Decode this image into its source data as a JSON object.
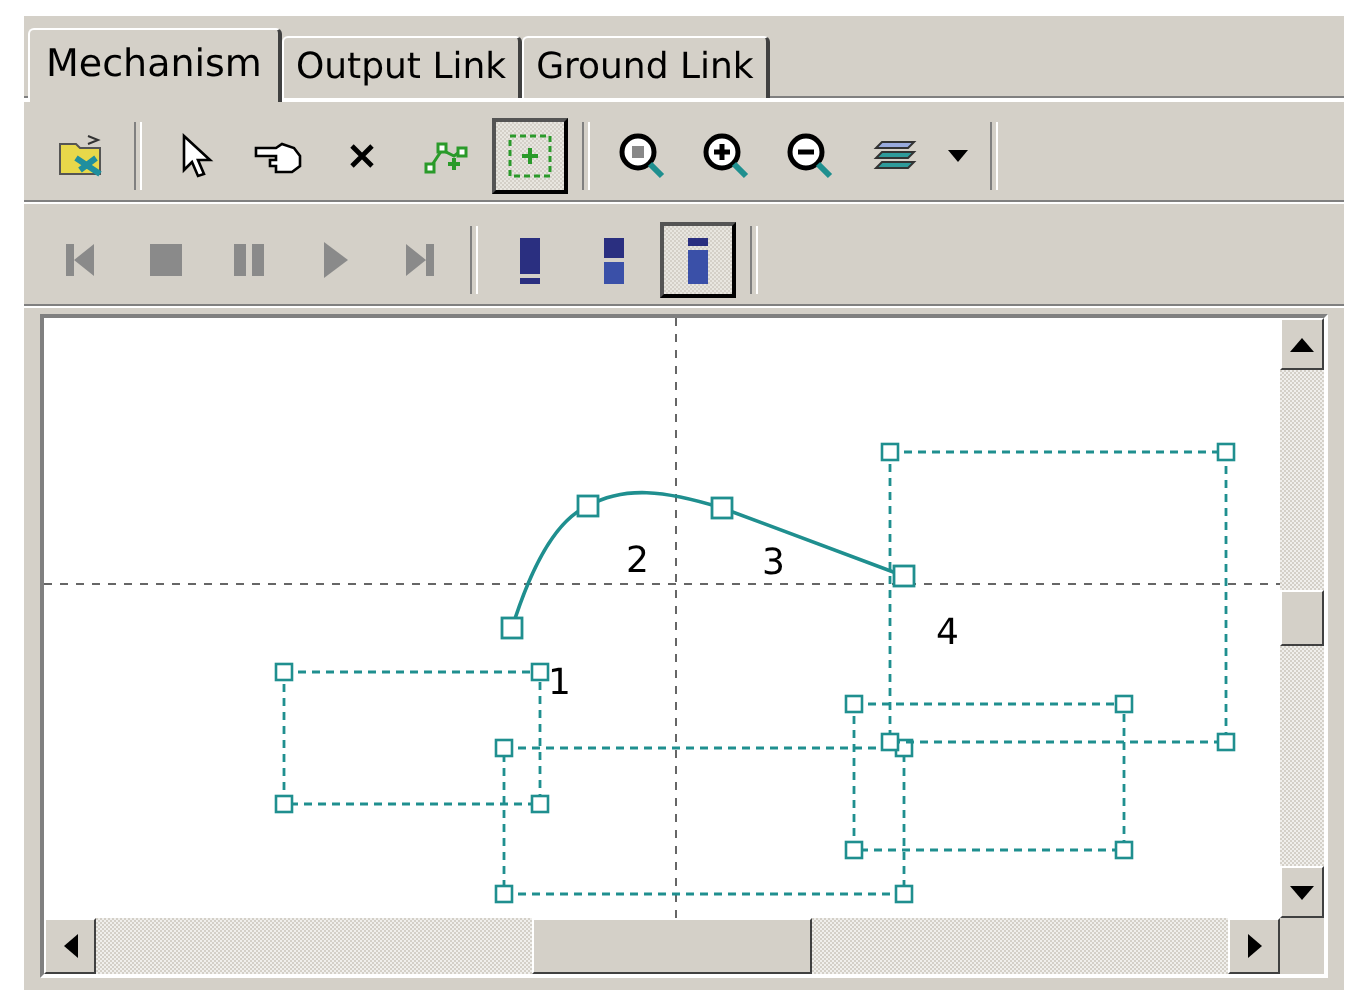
{
  "tabs": [
    {
      "label": "Mechanism",
      "selected": true
    },
    {
      "label": "Output Link",
      "selected": false
    },
    {
      "label": "Ground Link",
      "selected": false
    }
  ],
  "toolbar": [
    {
      "kind": "open",
      "selected": false
    },
    {
      "kind": "sep"
    },
    {
      "kind": "pointer",
      "selected": false
    },
    {
      "kind": "hand",
      "selected": false
    },
    {
      "kind": "delete",
      "selected": false
    },
    {
      "kind": "add-point",
      "selected": false
    },
    {
      "kind": "fit",
      "selected": true
    },
    {
      "kind": "sep"
    },
    {
      "kind": "zoom-window",
      "selected": false
    },
    {
      "kind": "zoom-in",
      "selected": false
    },
    {
      "kind": "zoom-out",
      "selected": false
    },
    {
      "kind": "layers",
      "selected": false
    },
    {
      "kind": "dropdown",
      "selected": false
    },
    {
      "kind": "sep"
    }
  ],
  "playback": [
    {
      "kind": "first",
      "selected": false,
      "disabled": true
    },
    {
      "kind": "stop",
      "selected": false,
      "disabled": true
    },
    {
      "kind": "pause",
      "selected": false,
      "disabled": true
    },
    {
      "kind": "play",
      "selected": false,
      "disabled": true
    },
    {
      "kind": "last",
      "selected": false,
      "disabled": true
    },
    {
      "kind": "sep"
    },
    {
      "kind": "view-top",
      "selected": false
    },
    {
      "kind": "view-split",
      "selected": false
    },
    {
      "kind": "view-bottom",
      "selected": true
    },
    {
      "kind": "sep"
    }
  ],
  "canvas": {
    "labels": [
      {
        "text": "1"
      },
      {
        "text": "2"
      },
      {
        "text": "3"
      },
      {
        "text": "4"
      }
    ]
  }
}
